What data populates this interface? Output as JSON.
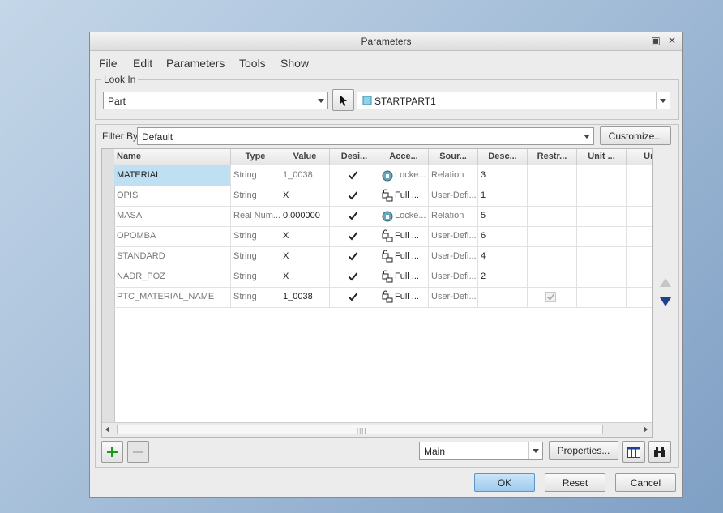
{
  "window": {
    "title": "Parameters"
  },
  "menu": [
    "File",
    "Edit",
    "Parameters",
    "Tools",
    "Show"
  ],
  "look_in": {
    "legend": "Look In",
    "type_value": "Part",
    "model_value": "STARTPART1"
  },
  "filter": {
    "label": "Filter By",
    "value": "Default",
    "customize_label": "Customize..."
  },
  "table": {
    "columns": [
      "Name",
      "Type",
      "Value",
      "Desi...",
      "Acce...",
      "Sour...",
      "Desc...",
      "Restr...",
      "Unit ...",
      "Uni"
    ],
    "rows": [
      {
        "name": "MATERIAL",
        "type": "String",
        "value": "1_0038",
        "access": "Locke...",
        "source": "Relation",
        "desc": "3"
      },
      {
        "name": "OPIS",
        "type": "String",
        "value": "X",
        "access": "Full   ...",
        "source": "User-Defi...",
        "desc": "1"
      },
      {
        "name": "MASA",
        "type": "Real Num...",
        "value": "0.000000",
        "access": "Locke...",
        "source": "Relation",
        "desc": "5"
      },
      {
        "name": "OPOMBA",
        "type": "String",
        "value": "X",
        "access": "Full   ...",
        "source": "User-Defi...",
        "desc": "6"
      },
      {
        "name": "STANDARD",
        "type": "String",
        "value": "X",
        "access": "Full   ...",
        "source": "User-Defi...",
        "desc": "4"
      },
      {
        "name": "NADR_POZ",
        "type": "String",
        "value": "X",
        "access": "Full   ...",
        "source": "User-Defi...",
        "desc": "2"
      },
      {
        "name": "PTC_MATERIAL_NAME",
        "type": "String",
        "value": "1_0038",
        "access": "Full   ...",
        "source": "User-Defi...",
        "desc": ""
      }
    ]
  },
  "bottom": {
    "view_value": "Main",
    "properties_label": "Properties...",
    "ok_label": "OK",
    "reset_label": "Reset",
    "cancel_label": "Cancel"
  },
  "colors": {
    "accent": "#bfe0f2",
    "ok_button": "#a9d2f0",
    "add_green": "#1a9a1a"
  }
}
